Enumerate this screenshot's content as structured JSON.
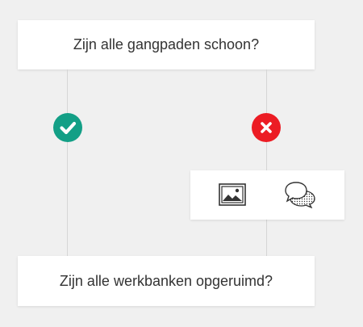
{
  "questions": [
    {
      "text": "Zijn alle gangpaden schoon?"
    },
    {
      "text": "Zijn alle werkbanken opgeruimd?"
    }
  ],
  "answers": {
    "yes": {
      "icon": "checkmark-icon",
      "color": "#139f86"
    },
    "no": {
      "icon": "x-icon",
      "color": "#ec1c24"
    }
  },
  "actions": [
    {
      "icon": "image-icon"
    },
    {
      "icon": "comments-icon"
    }
  ],
  "colors": {
    "background": "#f0f0f0",
    "card": "#ffffff",
    "text": "#333333",
    "connector": "#d6d6d6"
  }
}
